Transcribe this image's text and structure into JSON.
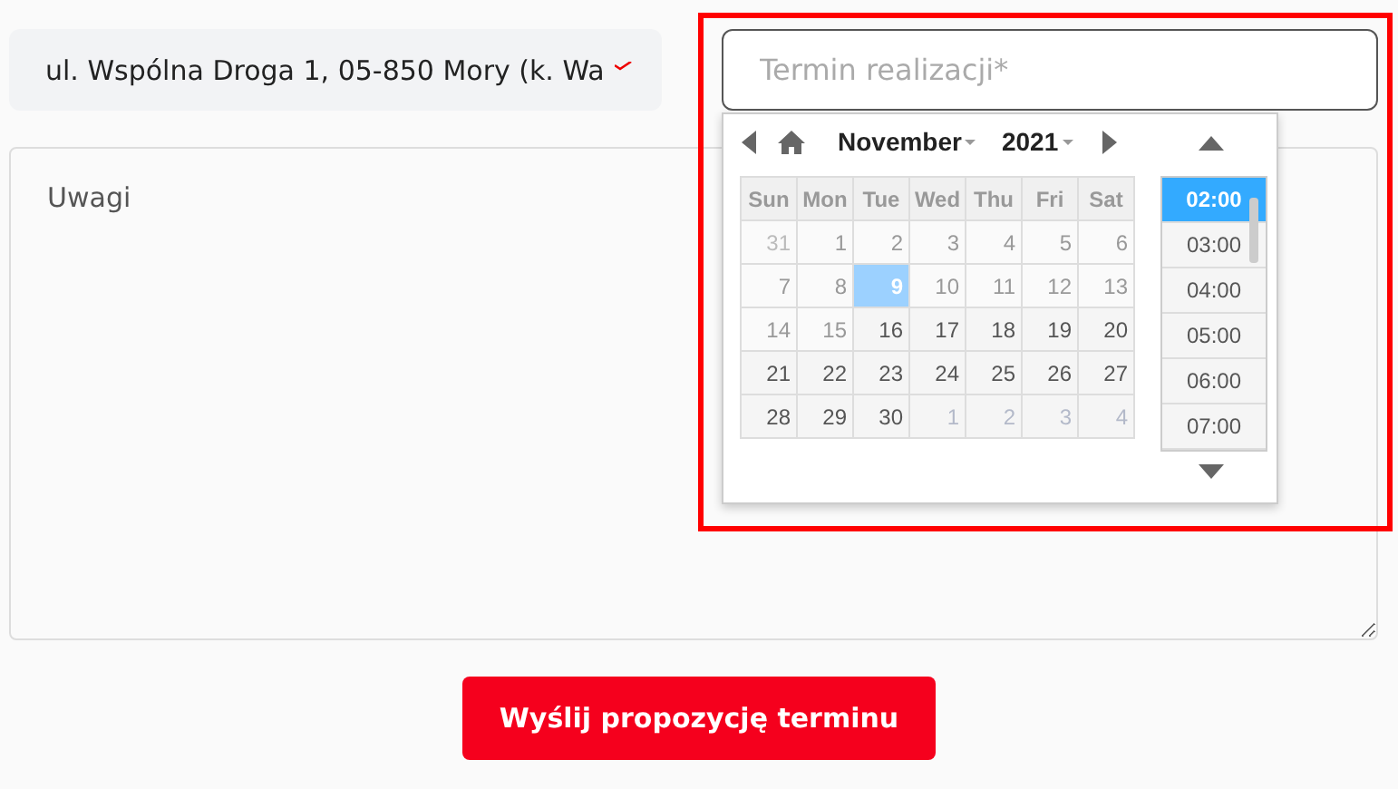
{
  "address_field": {
    "value": "ul. Wspólna Droga 1, 05-850 Mory (k. Wa"
  },
  "date_field": {
    "placeholder": "Termin realizacji*"
  },
  "notes_field": {
    "placeholder": "Uwagi"
  },
  "datepicker": {
    "month": "November",
    "year": "2021",
    "weekdays": [
      "Sun",
      "Mon",
      "Tue",
      "Wed",
      "Thu",
      "Fri",
      "Sat"
    ],
    "weeks": [
      [
        {
          "day": "31",
          "other_month": true,
          "disabled": true,
          "selected": false
        },
        {
          "day": "1",
          "other_month": false,
          "disabled": true,
          "selected": false
        },
        {
          "day": "2",
          "other_month": false,
          "disabled": true,
          "selected": false
        },
        {
          "day": "3",
          "other_month": false,
          "disabled": true,
          "selected": false
        },
        {
          "day": "4",
          "other_month": false,
          "disabled": true,
          "selected": false
        },
        {
          "day": "5",
          "other_month": false,
          "disabled": true,
          "selected": false
        },
        {
          "day": "6",
          "other_month": false,
          "disabled": true,
          "selected": false
        }
      ],
      [
        {
          "day": "7",
          "other_month": false,
          "disabled": true,
          "selected": false
        },
        {
          "day": "8",
          "other_month": false,
          "disabled": true,
          "selected": false
        },
        {
          "day": "9",
          "other_month": false,
          "disabled": false,
          "selected": true
        },
        {
          "day": "10",
          "other_month": false,
          "disabled": true,
          "selected": false
        },
        {
          "day": "11",
          "other_month": false,
          "disabled": true,
          "selected": false
        },
        {
          "day": "12",
          "other_month": false,
          "disabled": true,
          "selected": false
        },
        {
          "day": "13",
          "other_month": false,
          "disabled": true,
          "selected": false
        }
      ],
      [
        {
          "day": "14",
          "other_month": false,
          "disabled": true,
          "selected": false
        },
        {
          "day": "15",
          "other_month": false,
          "disabled": true,
          "selected": false
        },
        {
          "day": "16",
          "other_month": false,
          "disabled": false,
          "selected": false
        },
        {
          "day": "17",
          "other_month": false,
          "disabled": false,
          "selected": false
        },
        {
          "day": "18",
          "other_month": false,
          "disabled": false,
          "selected": false
        },
        {
          "day": "19",
          "other_month": false,
          "disabled": false,
          "selected": false
        },
        {
          "day": "20",
          "other_month": false,
          "disabled": false,
          "selected": false
        }
      ],
      [
        {
          "day": "21",
          "other_month": false,
          "disabled": false,
          "selected": false
        },
        {
          "day": "22",
          "other_month": false,
          "disabled": false,
          "selected": false
        },
        {
          "day": "23",
          "other_month": false,
          "disabled": false,
          "selected": false
        },
        {
          "day": "24",
          "other_month": false,
          "disabled": false,
          "selected": false
        },
        {
          "day": "25",
          "other_month": false,
          "disabled": false,
          "selected": false
        },
        {
          "day": "26",
          "other_month": false,
          "disabled": false,
          "selected": false
        },
        {
          "day": "27",
          "other_month": false,
          "disabled": false,
          "selected": false
        }
      ],
      [
        {
          "day": "28",
          "other_month": false,
          "disabled": false,
          "selected": false
        },
        {
          "day": "29",
          "other_month": false,
          "disabled": false,
          "selected": false
        },
        {
          "day": "30",
          "other_month": false,
          "disabled": false,
          "selected": false
        },
        {
          "day": "1",
          "other_month": true,
          "disabled": false,
          "selected": false
        },
        {
          "day": "2",
          "other_month": true,
          "disabled": false,
          "selected": false
        },
        {
          "day": "3",
          "other_month": true,
          "disabled": false,
          "selected": false
        },
        {
          "day": "4",
          "other_month": true,
          "disabled": false,
          "selected": false
        }
      ]
    ],
    "times": [
      {
        "label": "02:00",
        "selected": true
      },
      {
        "label": "03:00",
        "selected": false
      },
      {
        "label": "04:00",
        "selected": false
      },
      {
        "label": "05:00",
        "selected": false
      },
      {
        "label": "06:00",
        "selected": false
      },
      {
        "label": "07:00",
        "selected": false
      }
    ]
  },
  "submit_button": {
    "label": "Wyślij propozycję terminu"
  }
}
